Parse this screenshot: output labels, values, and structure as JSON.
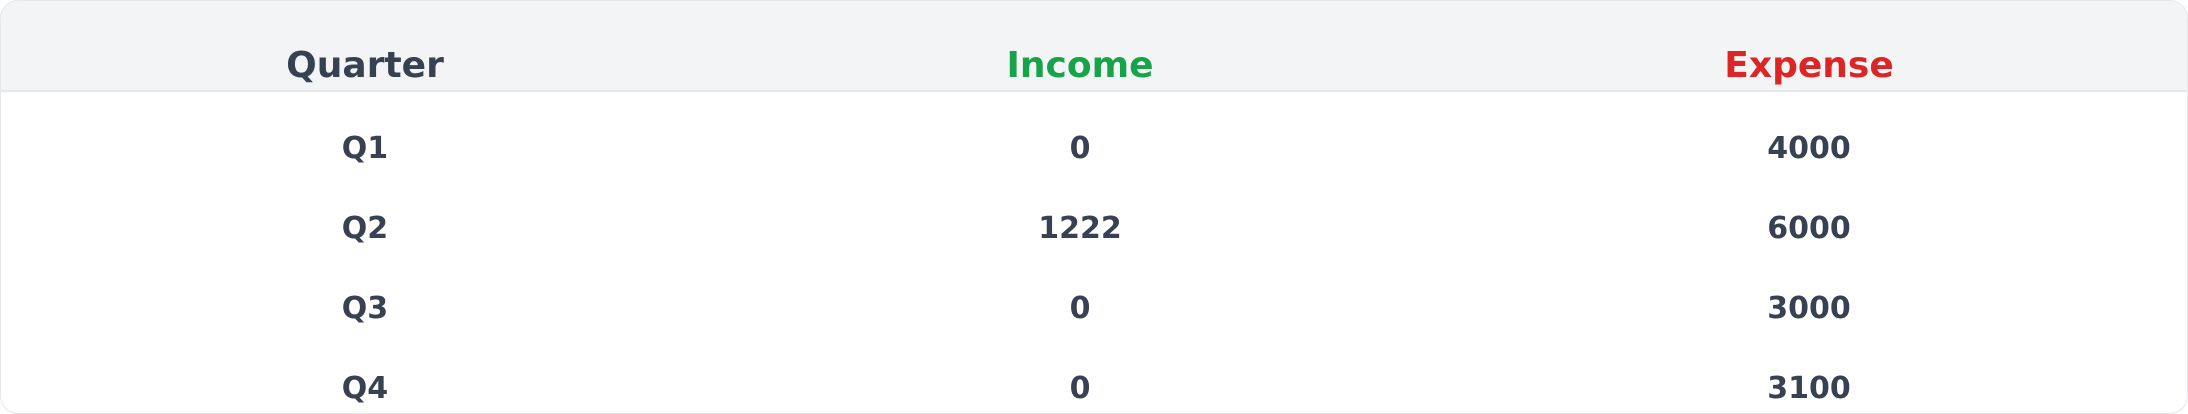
{
  "colors": {
    "header_text": "#374151",
    "income": "#16a34a",
    "expense": "#dc2626",
    "cell_text": "#374151",
    "header_bg": "#f3f4f6",
    "border": "#e5e7eb"
  },
  "table": {
    "headers": {
      "quarter": "Quarter",
      "income": "Income",
      "expense": "Expense"
    },
    "rows": [
      {
        "quarter": "Q1",
        "income": "0",
        "expense": "4000"
      },
      {
        "quarter": "Q2",
        "income": "1222",
        "expense": "6000"
      },
      {
        "quarter": "Q3",
        "income": "0",
        "expense": "3000"
      },
      {
        "quarter": "Q4",
        "income": "0",
        "expense": "3100"
      }
    ]
  }
}
